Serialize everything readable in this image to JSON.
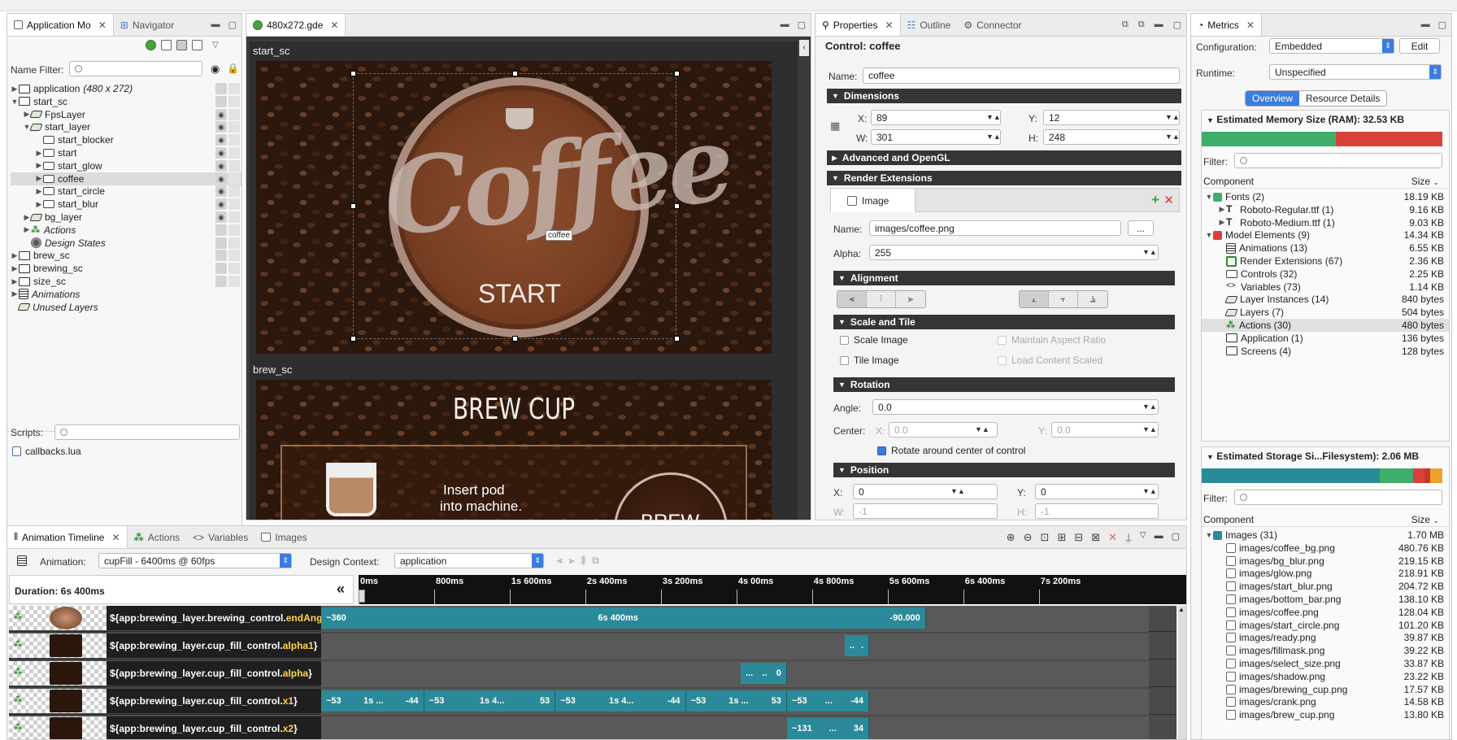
{
  "app_model": {
    "tabs": [
      {
        "label": "Application Mo"
      },
      {
        "label": "Navigator"
      }
    ],
    "name_filter_label": "Name Filter:",
    "tree": [
      {
        "label": "application",
        "suffix": "(480 x 272)",
        "depth": 0,
        "icon": "screen-icon",
        "italic": false
      },
      {
        "label": "start_sc",
        "depth": 0,
        "icon": "screen-icon"
      },
      {
        "label": "FpsLayer",
        "depth": 1,
        "icon": "layer-icon"
      },
      {
        "label": "start_layer",
        "depth": 1,
        "icon": "layer-icon"
      },
      {
        "label": "start_blocker",
        "depth": 2,
        "icon": "control-icon"
      },
      {
        "label": "start",
        "depth": 2,
        "icon": "control-icon"
      },
      {
        "label": "start_glow",
        "depth": 2,
        "icon": "control-icon"
      },
      {
        "label": "coffee",
        "depth": 2,
        "icon": "control-icon",
        "selected": true
      },
      {
        "label": "start_circle",
        "depth": 2,
        "icon": "control-icon"
      },
      {
        "label": "start_blur",
        "depth": 2,
        "icon": "control-icon"
      },
      {
        "label": "bg_layer",
        "depth": 1,
        "icon": "layer-icon"
      },
      {
        "label": "Actions",
        "depth": 1,
        "icon": "actions-icon",
        "italic": true
      },
      {
        "label": "Design States",
        "depth": 1,
        "icon": "design-states-icon",
        "italic": true
      },
      {
        "label": "brew_sc",
        "depth": 0,
        "icon": "screen-icon"
      },
      {
        "label": "brewing_sc",
        "depth": 0,
        "icon": "screen-icon"
      },
      {
        "label": "size_sc",
        "depth": 0,
        "icon": "screen-icon"
      },
      {
        "label": "Animations",
        "depth": 0,
        "icon": "film-icon",
        "italic": true
      },
      {
        "label": "Unused Layers",
        "depth": 0,
        "icon": "layer-icon",
        "italic": true
      }
    ],
    "scripts_label": "Scripts:",
    "scripts": [
      "callbacks.lua"
    ]
  },
  "editor": {
    "tab": "480x272.gde",
    "screen1": "start_sc",
    "screen2": "brew_sc",
    "coffee_text": "Coffee",
    "start_text": "START",
    "selection_label": "coffee",
    "brew_title": "BREW CUP",
    "insert_line1": "Insert pod",
    "insert_line2": "into machine.",
    "brew_btn": "BREW"
  },
  "properties": {
    "tabs": [
      {
        "label": "Properties"
      },
      {
        "label": "Outline"
      },
      {
        "label": "Connector"
      }
    ],
    "control_title": "Control: coffee",
    "name_label": "Name:",
    "name_value": "coffee",
    "sec_dimensions": "Dimensions",
    "x_label": "X:",
    "x_value": "89",
    "y_label": "Y:",
    "y_value": "12",
    "w_label": "W:",
    "w_value": "301",
    "h_label": "H:",
    "h_value": "248",
    "sec_advanced": "Advanced and OpenGL",
    "sec_render": "Render Extensions",
    "image_tab": "Image",
    "img_name_label": "Name:",
    "img_name_value": "images/coffee.png",
    "browse": "...",
    "alpha_label": "Alpha:",
    "alpha_value": "255",
    "sec_alignment": "Alignment",
    "sec_scale": "Scale and Tile",
    "scale_image": "Scale Image",
    "maintain_aspect": "Maintain Aspect Ratio",
    "tile_image": "Tile Image",
    "load_scaled": "Load Content Scaled",
    "sec_rotation": "Rotation",
    "angle_label": "Angle:",
    "angle_value": "0.0",
    "center_label": "Center:",
    "cx_label": "X:",
    "cx_value": "0.0",
    "cy_label": "Y:",
    "cy_value": "0.0",
    "rotate_center": "Rotate around center of control",
    "sec_position": "Position",
    "px_label": "X:",
    "px_value": "0",
    "py_label": "Y:",
    "py_value": "0",
    "pw_label": "W:",
    "pw_value": "-1",
    "ph_label": "H:",
    "ph_value": "-1"
  },
  "metrics": {
    "tab": "Metrics",
    "config_label": "Configuration:",
    "config_value": "Embedded",
    "edit": "Edit",
    "runtime_label": "Runtime:",
    "runtime_value": "Unspecified",
    "tab_overview": "Overview",
    "tab_resource": "Resource Details",
    "mem_title": "Estimated Memory Size (RAM): 32.53 KB",
    "filter_label": "Filter:",
    "col_component": "Component",
    "col_size": "Size",
    "mem_rows": [
      {
        "label": "Fonts (2)",
        "size": "18.19 KB",
        "depth": 0,
        "color": "#3fae6a",
        "icon": "square"
      },
      {
        "label": "Roboto-Regular.ttf (1)",
        "size": "9.16 KB",
        "depth": 1,
        "icon": "font-icon"
      },
      {
        "label": "Roboto-Medium.ttf (1)",
        "size": "9.03 KB",
        "depth": 1,
        "icon": "font-icon"
      },
      {
        "label": "Model Elements (9)",
        "size": "14.34 KB",
        "depth": 0,
        "color": "#d9403a",
        "icon": "square"
      },
      {
        "label": "Animations (13)",
        "size": "6.55 KB",
        "depth": 1,
        "icon": "film-icon"
      },
      {
        "label": "Render Extensions (67)",
        "size": "2.36 KB",
        "depth": 1,
        "icon": "render-icon"
      },
      {
        "label": "Controls (32)",
        "size": "2.25 KB",
        "depth": 1,
        "icon": "control-icon"
      },
      {
        "label": "Variables (73)",
        "size": "1.14 KB",
        "depth": 1,
        "icon": "variable-icon"
      },
      {
        "label": "Layer Instances (14)",
        "size": "840 bytes",
        "depth": 1,
        "icon": "layer-icon"
      },
      {
        "label": "Layers (7)",
        "size": "504 bytes",
        "depth": 1,
        "icon": "layer-icon"
      },
      {
        "label": "Actions (30)",
        "size": "480 bytes",
        "depth": 1,
        "icon": "actions-icon",
        "selected": true
      },
      {
        "label": "Application (1)",
        "size": "136 bytes",
        "depth": 1,
        "icon": "screen-icon"
      },
      {
        "label": "Screens (4)",
        "size": "128 bytes",
        "depth": 1,
        "icon": "screen-icon"
      }
    ],
    "mem_bar": [
      {
        "frac": 0.558,
        "color": "#3fae6a"
      },
      {
        "frac": 0.442,
        "color": "#d9403a"
      }
    ],
    "storage_title": "Estimated Storage Si...Filesystem): 2.06 MB",
    "storage_bar": [
      {
        "frac": 0.74,
        "color": "#2b8a99"
      },
      {
        "frac": 0.14,
        "color": "#3fae6a"
      },
      {
        "frac": 0.045,
        "color": "#d9403a"
      },
      {
        "frac": 0.025,
        "color": "#c0392b"
      },
      {
        "frac": 0.05,
        "color": "#f0a030"
      }
    ],
    "storage_rows": [
      {
        "label": "Images (31)",
        "size": "1.70 MB",
        "depth": 0,
        "color": "#2b8a99",
        "icon": "square"
      },
      {
        "label": "images/coffee_bg.png",
        "size": "480.76 KB",
        "depth": 1,
        "icon": "image-icon"
      },
      {
        "label": "images/bg_blur.png",
        "size": "219.15 KB",
        "depth": 1,
        "icon": "image-icon"
      },
      {
        "label": "images/glow.png",
        "size": "218.91 KB",
        "depth": 1,
        "icon": "image-icon"
      },
      {
        "label": "images/start_blur.png",
        "size": "204.72 KB",
        "depth": 1,
        "icon": "image-icon"
      },
      {
        "label": "images/bottom_bar.png",
        "size": "138.10 KB",
        "depth": 1,
        "icon": "image-icon"
      },
      {
        "label": "images/coffee.png",
        "size": "128.04 KB",
        "depth": 1,
        "icon": "image-icon"
      },
      {
        "label": "images/start_circle.png",
        "size": "101.20 KB",
        "depth": 1,
        "icon": "image-icon"
      },
      {
        "label": "images/ready.png",
        "size": "39.87 KB",
        "depth": 1,
        "icon": "image-icon"
      },
      {
        "label": "images/fillmask.png",
        "size": "39.22 KB",
        "depth": 1,
        "icon": "image-icon"
      },
      {
        "label": "images/select_size.png",
        "size": "33.87 KB",
        "depth": 1,
        "icon": "image-icon"
      },
      {
        "label": "images/shadow.png",
        "size": "23.22 KB",
        "depth": 1,
        "icon": "image-icon"
      },
      {
        "label": "images/brewing_cup.png",
        "size": "17.57 KB",
        "depth": 1,
        "icon": "image-icon"
      },
      {
        "label": "images/crank.png",
        "size": "14.58 KB",
        "depth": 1,
        "icon": "image-icon"
      },
      {
        "label": "images/brew_cup.png",
        "size": "13.80 KB",
        "depth": 1,
        "icon": "image-icon"
      }
    ]
  },
  "timeline": {
    "tabs": [
      {
        "label": "Animation Timeline"
      },
      {
        "label": "Actions"
      },
      {
        "label": "Variables"
      },
      {
        "label": "Images"
      }
    ],
    "animation_label": "Animation:",
    "animation_value": "cupFill - 6400ms @ 60fps",
    "context_label": "Design Context:",
    "context_value": "application",
    "duration": "Duration: 6s 400ms",
    "collapse": "«",
    "ruler": [
      "0ms",
      "800ms",
      "1s 600ms",
      "2s 400ms",
      "3s 200ms",
      "4s 00ms",
      "4s 800ms",
      "5s 600ms",
      "6s 400ms",
      "7s 200ms"
    ],
    "rows": [
      {
        "var_prefix": "${app:brewing_layer.brewing_control.",
        "var_prop": "endAngle",
        "var_suffix": "}",
        "segments": [
          {
            "t0": 0,
            "t1": 6400,
            "labels": [
              "~360",
              "6s 400ms",
              "-90.000"
            ]
          }
        ]
      },
      {
        "var_prefix": "${app:brewing_layer.cup_fill_control.",
        "var_prop": "alpha1",
        "var_suffix": "}",
        "segments": [
          {
            "t0": 5540,
            "t1": 5800,
            "labels": [
              "..",
              "."
            ]
          }
        ]
      },
      {
        "var_prefix": "${app:brewing_layer.cup_fill_control.",
        "var_prop": "alpha",
        "var_suffix": "}",
        "segments": [
          {
            "t0": 4440,
            "t1": 4930,
            "labels": [
              "...",
              "..",
              "0"
            ]
          }
        ]
      },
      {
        "var_prefix": "${app:brewing_layer.cup_fill_control.",
        "var_prop": "x1",
        "var_suffix": "}",
        "segments": [
          {
            "t0": 0,
            "t1": 1090,
            "labels": [
              "~53",
              "1s ...",
              "-44"
            ]
          },
          {
            "t0": 1090,
            "t1": 2480,
            "labels": [
              "~53",
              "1s 4...",
              "53"
            ]
          },
          {
            "t0": 2480,
            "t1": 3860,
            "labels": [
              "~53",
              "1s 4...",
              "-44"
            ]
          },
          {
            "t0": 3860,
            "t1": 4930,
            "labels": [
              "~53",
              "1s ...",
              "53"
            ]
          },
          {
            "t0": 4930,
            "t1": 5800,
            "labels": [
              "~53",
              "...",
              "-44"
            ]
          }
        ]
      },
      {
        "var_prefix": "${app:brewing_layer.cup_fill_control.",
        "var_prop": "x2",
        "var_suffix": "}",
        "segments": [
          {
            "t0": 4930,
            "t1": 5800,
            "labels": [
              "~131",
              "...",
              "34"
            ]
          }
        ]
      }
    ]
  }
}
